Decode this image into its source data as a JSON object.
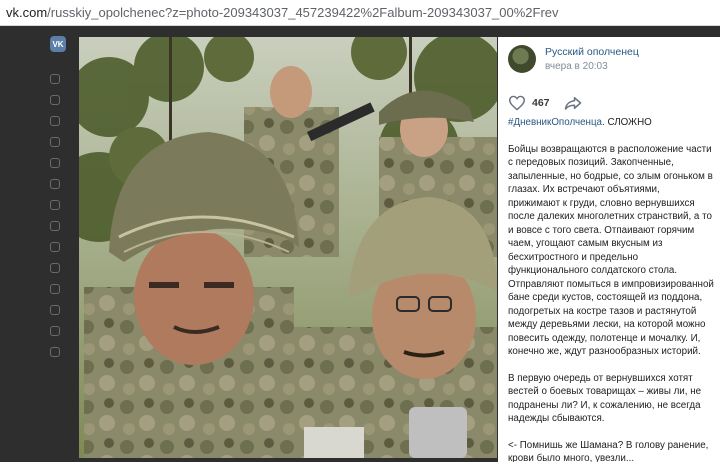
{
  "browser": {
    "url_host": "vk.com",
    "url_path": "/russkiy_opolchenec?z=photo-209343037_457239422%2Falbum-209343037_00%2Frev"
  },
  "site": {
    "logo_text": "VK"
  },
  "post": {
    "author": "Русский ополченец",
    "time": "вчера в 20:03",
    "likes": "467",
    "hashtag": "#ДневникОполченца",
    "headline": ". СЛОЖНО",
    "paragraph1": "Бойцы возвращаются в расположение части с передовых позиций. Закопченные, запыленные, но бодрые, со злым огоньком в глазах. Их встречают объятиями, прижимают к груди, словно вернувшихся после далеких многолетних странствий, а то и вовсе с того света. Отпаивают горячим чаем, угощают самым вкусным из бесхитростного и предельно функционального солдатского стола. Отправляют помыться в импровизированной бане среди кустов, состоящей из поддона, подогретых на костре тазов и растянутой между деревьями лески, на которой можно повесить одежду, полотенце и мочалку. И, конечно же, ждут разнообразных историй.",
    "paragraph2": "В первую очередь от вернувшихся хотят вестей о боевых товарищах – живы ли, не подранены ли? И, к сожалению, не всегда надежды сбываются.",
    "paragraph3": "<- Помнишь же Шамана? В голову ранение, крови было много, увезли..."
  },
  "colors": {
    "link": "#2a5885",
    "muted": "#818c99",
    "backdrop": "#2e2e2f"
  }
}
